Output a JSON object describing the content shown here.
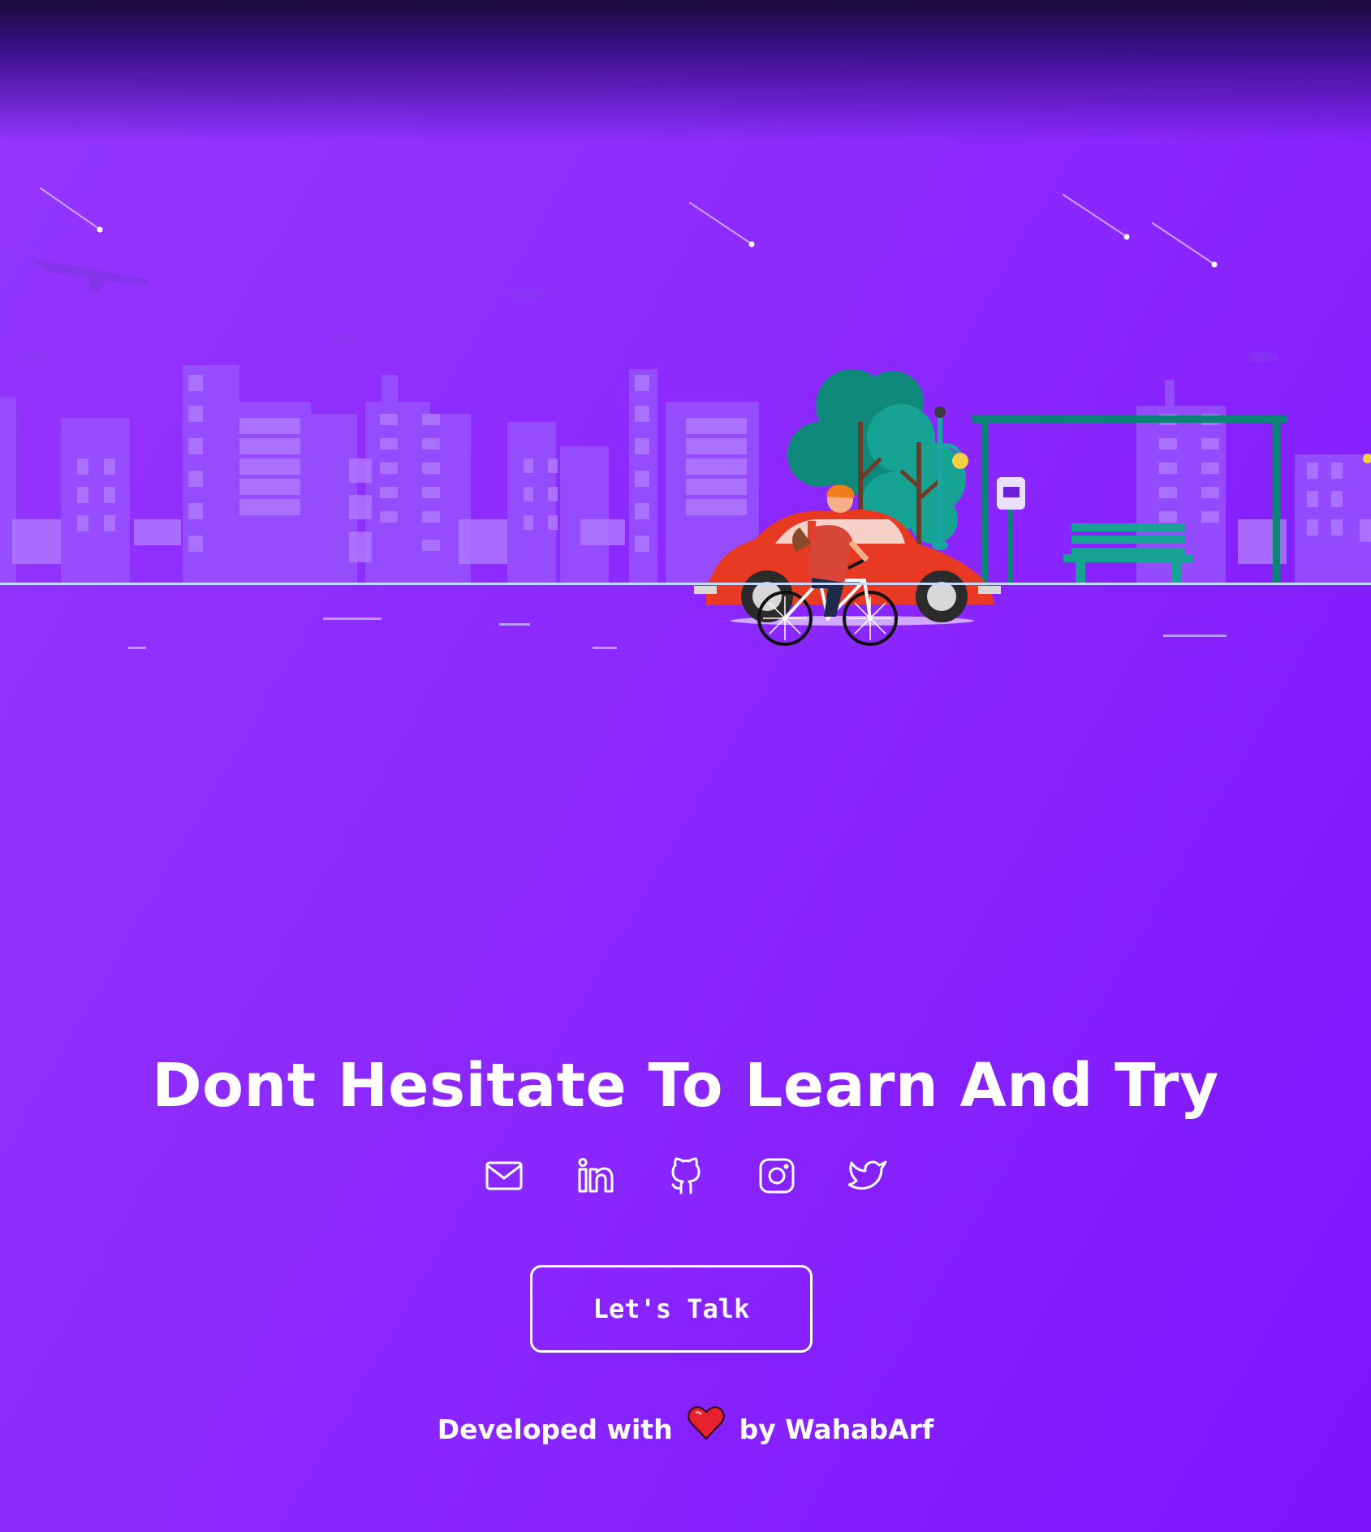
{
  "headline": "Dont Hesitate To Learn And Try",
  "socials": [
    {
      "name": "Email",
      "icon": "mail-icon"
    },
    {
      "name": "LinkedIn",
      "icon": "linkedin-icon"
    },
    {
      "name": "GitHub",
      "icon": "github-icon"
    },
    {
      "name": "Instagram",
      "icon": "instagram-icon"
    },
    {
      "name": "Twitter",
      "icon": "twitter-icon"
    }
  ],
  "cta": {
    "label": "Let's Talk"
  },
  "footer": {
    "prefix": "Developed with",
    "heart_icon": "heart-icon",
    "suffix": "by WahabArf"
  },
  "colors": {
    "background": "#8a26ff",
    "top_shade": "#1b0b3a",
    "text": "#ffffff",
    "buildings": "#9d55ff",
    "trees": "#149a8a",
    "car": "#e83a23",
    "heart": "#e8212e"
  }
}
